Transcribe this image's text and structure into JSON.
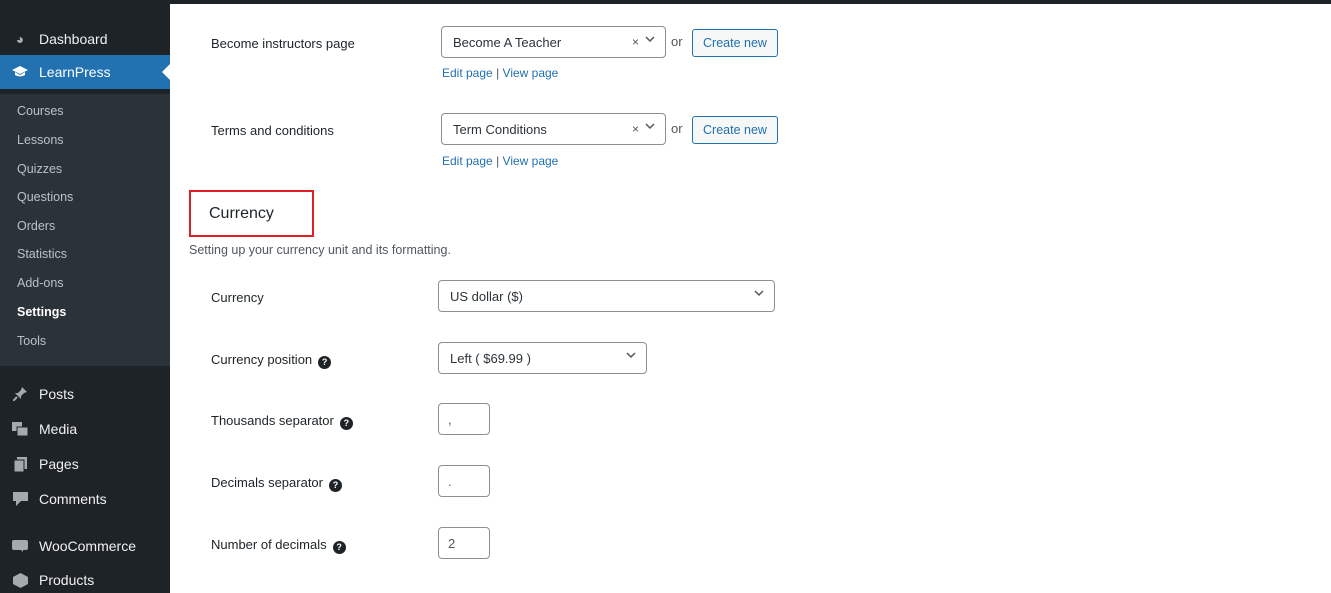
{
  "sidebar": {
    "top": [
      {
        "label": "Dashboard",
        "icon": "dashboard-icon"
      },
      {
        "label": "LearnPress",
        "icon": "graduation-cap-icon"
      }
    ],
    "submenu": [
      "Courses",
      "Lessons",
      "Quizzes",
      "Questions",
      "Orders",
      "Statistics",
      "Add-ons",
      "Settings",
      "Tools"
    ],
    "bottom": [
      {
        "label": "Posts",
        "icon": "pushpin-icon"
      },
      {
        "label": "Media",
        "icon": "media-icon"
      },
      {
        "label": "Pages",
        "icon": "pages-icon"
      },
      {
        "label": "Comments",
        "icon": "comment-icon"
      },
      {
        "label": "WooCommerce",
        "icon": "woocommerce-icon"
      },
      {
        "label": "Products",
        "icon": "products-icon"
      }
    ]
  },
  "pages": {
    "instructors": {
      "label": "Become instructors page",
      "value": "Become A Teacher",
      "clear": "×",
      "or": "or",
      "create": "Create new",
      "edit": "Edit page",
      "sep": "|",
      "view": "View page"
    },
    "terms": {
      "label": "Terms and conditions",
      "value": "Term Conditions",
      "clear": "×",
      "or": "or",
      "create": "Create new",
      "edit": "Edit page",
      "sep": "|",
      "view": "View page"
    }
  },
  "currency_section": {
    "heading": "Currency",
    "description": "Setting up your currency unit and its formatting.",
    "currency": {
      "label": "Currency",
      "value": "US dollar ($)"
    },
    "position": {
      "label": "Currency position",
      "value": "Left ( $69.99 )"
    },
    "thousands": {
      "label": "Thousands separator",
      "value": ","
    },
    "decimals": {
      "label": "Decimals separator",
      "value": "."
    },
    "num_decimals": {
      "label": "Number of decimals",
      "value": "2"
    }
  },
  "colors": {
    "accent": "#2271b1",
    "sidebar": "#1d2327",
    "highlight": "#e01e26"
  }
}
